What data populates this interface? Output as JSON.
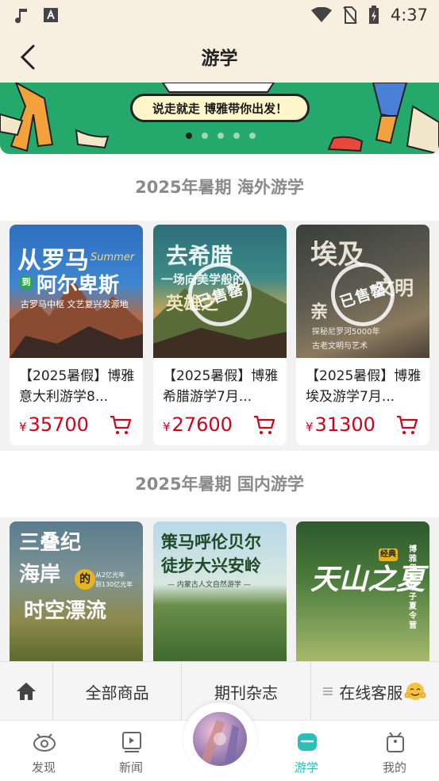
{
  "status_bar": {
    "time": "4:37"
  },
  "nav": {
    "title": "游学"
  },
  "banner": {
    "slogan": "说走就走  博雅带你出发！"
  },
  "sections": [
    {
      "title": "2025年暑期 海外游学",
      "products": [
        {
          "title": "【2025暑假】博雅意大利游学8...",
          "price": "35700",
          "image_text": [
            "从罗马",
            "到",
            "阿尔卑斯",
            "Summer",
            "古罗马中枢 文艺复兴发源地"
          ]
        },
        {
          "title": "【2025暑假】博雅希腊游学7月...",
          "price": "27600",
          "image_text": [
            "去希腊",
            "一场向美学般的",
            "英雄之"
          ],
          "stamp": "已售罄"
        },
        {
          "title": "【2025暑假】博雅埃及游学7月...",
          "price": "31300",
          "image_text": [
            "埃及",
            "文明",
            "亲",
            "探秘尼罗河5000年",
            "古老文明与艺术"
          ],
          "stamp": "已售罄"
        }
      ]
    },
    {
      "title": "2025年暑期 国内游学",
      "products": [
        {
          "image_text": [
            "三叠纪",
            "海岸",
            "的",
            "时空漂流",
            "从2亿光年",
            "到130亿光年"
          ]
        },
        {
          "image_text": [
            "策马呼伦贝尔",
            "徒步大兴安岭",
            "— 内蒙古人文自然游学 —"
          ]
        },
        {
          "image_text": [
            "天山之夏",
            "经典",
            "博雅伊犁亲子夏令营"
          ]
        }
      ]
    }
  ],
  "currency": "¥",
  "bottom_menu": [
    "全部商品",
    "期刊杂志",
    "在线客服"
  ],
  "tabs": [
    {
      "label": "发现",
      "icon": "eye-icon"
    },
    {
      "label": "新闻",
      "icon": "news-icon"
    },
    {
      "label": "游学",
      "icon": "travel-icon",
      "active": true
    },
    {
      "label": "我的",
      "icon": "profile-icon"
    }
  ],
  "colors": {
    "accent": "#2bbfb8",
    "price": "#d0021b",
    "header_bg": "#f8efe0",
    "banner": "#25a86b"
  }
}
